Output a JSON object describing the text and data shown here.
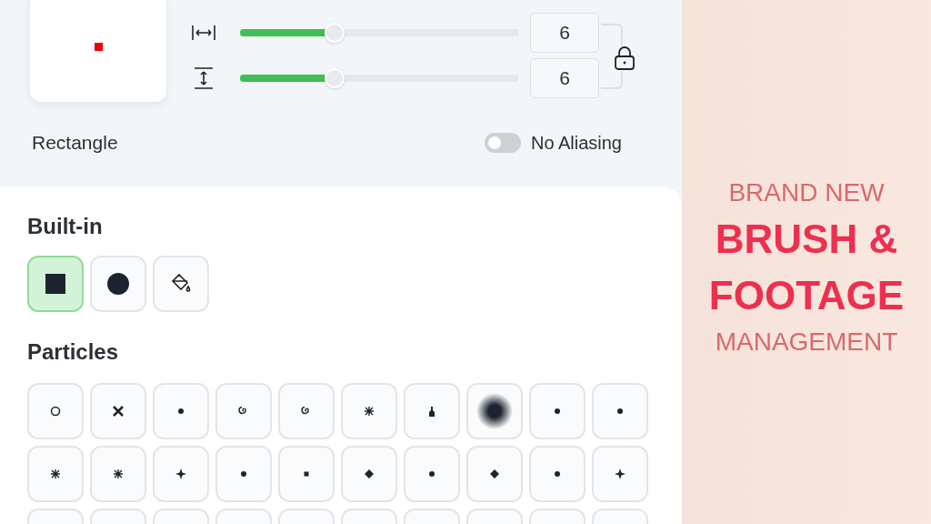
{
  "brush_settings": {
    "size_sliders": [
      {
        "kind": "width",
        "level": 0.34,
        "value": "6"
      },
      {
        "kind": "height",
        "level": 0.34,
        "value": "6"
      }
    ],
    "shape_label": "Rectangle",
    "no_aliasing": {
      "label": "No Aliasing",
      "on": false
    }
  },
  "built_in": {
    "title": "Built-in",
    "items": [
      {
        "kind": "square",
        "selected": true
      },
      {
        "kind": "circle",
        "selected": false
      },
      {
        "kind": "fill",
        "selected": false
      }
    ]
  },
  "particles": {
    "title": "Particles",
    "items": [
      {
        "selected": false
      },
      {
        "selected": false
      },
      {
        "selected": false
      },
      {
        "selected": false
      },
      {
        "selected": false
      },
      {
        "selected": false
      },
      {
        "selected": false
      },
      {
        "selected": false
      },
      {
        "selected": false
      },
      {
        "selected": false
      },
      {
        "selected": false
      },
      {
        "selected": false
      },
      {
        "selected": false
      },
      {
        "selected": false
      },
      {
        "selected": false
      },
      {
        "selected": false
      },
      {
        "selected": false
      },
      {
        "selected": false
      },
      {
        "selected": false
      },
      {
        "selected": false
      },
      {
        "selected": false
      },
      {
        "selected": false
      },
      {
        "selected": false
      },
      {
        "selected": false
      },
      {
        "selected": false
      },
      {
        "selected": false
      },
      {
        "selected": false
      },
      {
        "selected": false
      },
      {
        "selected": false
      },
      {
        "selected": false
      }
    ]
  },
  "promo": {
    "lines": [
      {
        "kind": "small",
        "text": "BRAND NEW"
      },
      {
        "kind": "big",
        "text": "BRUSH &"
      },
      {
        "kind": "big",
        "text": "FOOTAGE"
      },
      {
        "kind": "small",
        "text": "MANAGEMENT"
      }
    ]
  }
}
